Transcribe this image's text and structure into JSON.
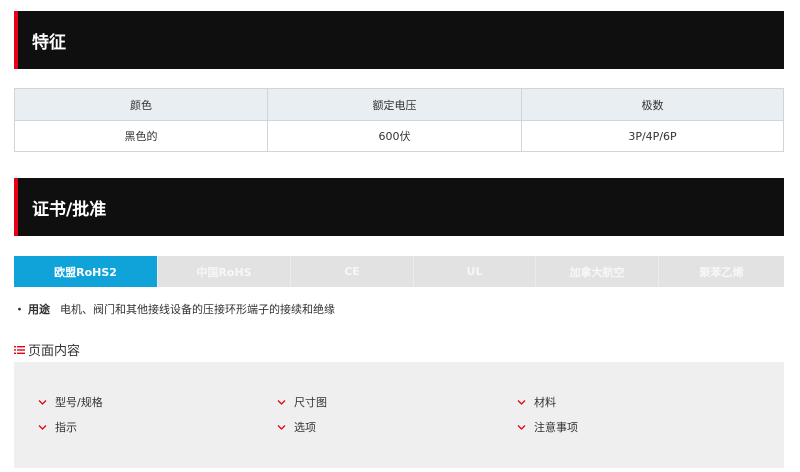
{
  "features": {
    "title": "特征",
    "table": {
      "headers": [
        "颜色",
        "额定电压",
        "极数"
      ],
      "row": [
        "黑色的",
        "600伏",
        "3P/4P/6P"
      ]
    }
  },
  "certifications": {
    "title": "证书/批准",
    "tabs": [
      {
        "label": "欧盟RoHS2",
        "active": true
      },
      {
        "label": "中国RoHS",
        "active": false
      },
      {
        "label": "CE",
        "active": false
      },
      {
        "label": "UL",
        "active": false
      },
      {
        "label": "加拿大航空",
        "active": false
      },
      {
        "label": "聚苯乙烯",
        "active": false
      }
    ],
    "usage_bullet": "・",
    "usage_label": "用途",
    "usage_text": "电机、阀门和其他接线设备的压接环形端子的接续和绝缘"
  },
  "page_contents": {
    "title": "页面内容",
    "items": [
      "型号/规格",
      "尺寸图",
      "材料",
      "指示",
      "选项",
      "注意事项"
    ]
  },
  "colors": {
    "accent_red": "#e60012",
    "active_tab": "#0fa3da",
    "header_bg": "#0f0f10"
  }
}
